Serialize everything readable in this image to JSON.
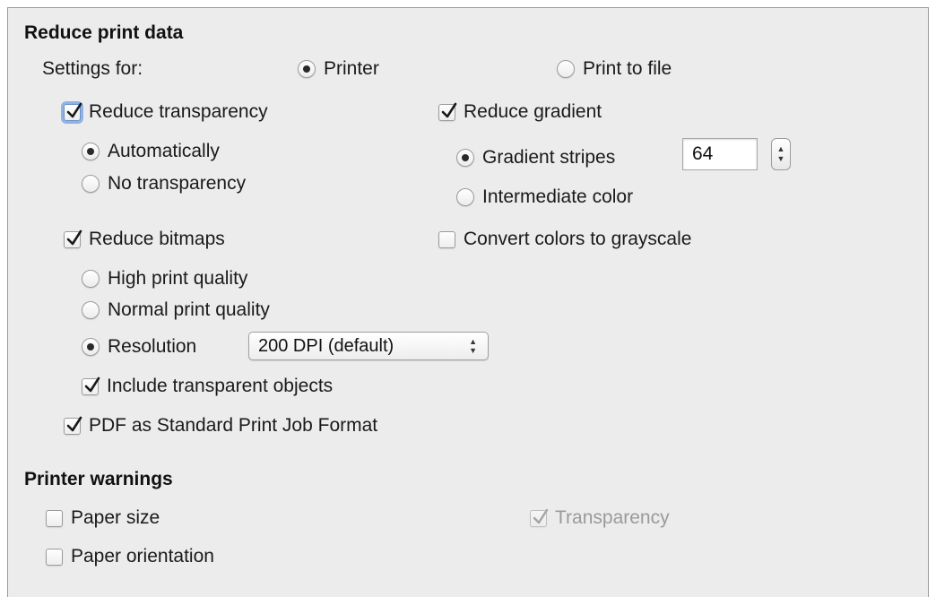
{
  "reduce_print_data": {
    "heading": "Reduce print data",
    "settings_for_label": "Settings for:",
    "settings_for": {
      "printer": {
        "label": "Printer",
        "selected": true
      },
      "print_to_file": {
        "label": "Print to file",
        "selected": false
      }
    },
    "reduce_transparency": {
      "label": "Reduce transparency",
      "checked": true,
      "options": [
        {
          "label": "Automatically",
          "selected": true
        },
        {
          "label": "No transparency",
          "selected": false
        }
      ]
    },
    "reduce_gradient": {
      "label": "Reduce gradient",
      "checked": true,
      "gradient_stripes": {
        "label": "Gradient stripes",
        "selected": true,
        "value": "64"
      },
      "intermediate_color": {
        "label": "Intermediate color",
        "selected": false
      }
    },
    "reduce_bitmaps": {
      "label": "Reduce bitmaps",
      "checked": true,
      "high_quality": {
        "label": "High print quality",
        "selected": false
      },
      "normal_quality": {
        "label": "Normal print quality",
        "selected": false
      },
      "resolution": {
        "label": "Resolution",
        "selected": true,
        "value": "200 DPI (default)"
      },
      "include_transparent": {
        "label": "Include transparent objects",
        "checked": true
      }
    },
    "convert_grayscale": {
      "label": "Convert colors to grayscale",
      "checked": false
    },
    "pdf_standard": {
      "label": "PDF as Standard Print Job Format",
      "checked": true
    }
  },
  "printer_warnings": {
    "heading": "Printer warnings",
    "paper_size": {
      "label": "Paper size",
      "checked": false
    },
    "paper_orientation": {
      "label": "Paper orientation",
      "checked": false
    },
    "transparency": {
      "label": "Transparency",
      "checked": true,
      "enabled": false
    }
  },
  "colors": {
    "panel_bg": "#ececec",
    "focus_ring": "#8fb3e6",
    "disabled_text": "#9a9a9a"
  }
}
